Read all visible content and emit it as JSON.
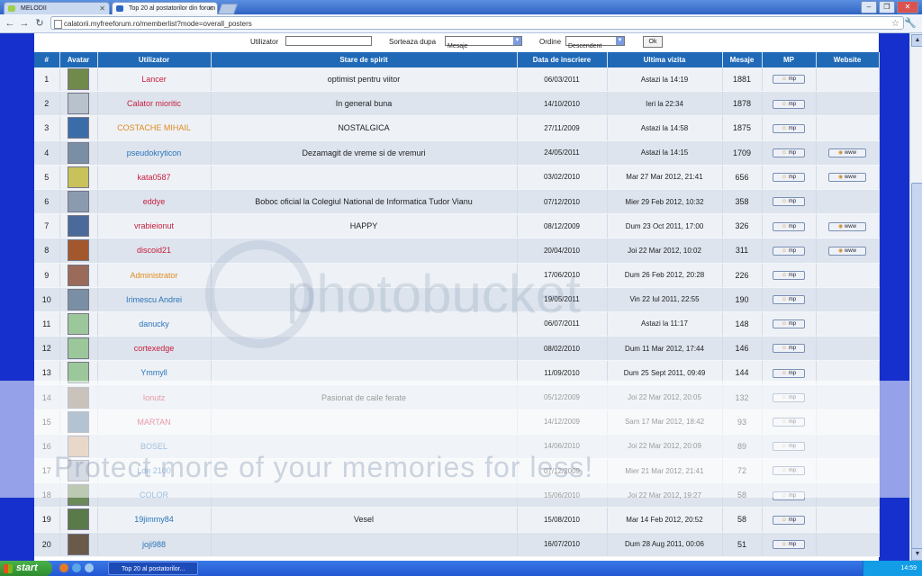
{
  "browser": {
    "tabs": [
      {
        "label": "MELODII",
        "favicon_color": "#9fcf4a"
      },
      {
        "label": "Top 20 al postatorilor din forum",
        "favicon_color": "#2b65c4"
      }
    ],
    "url": "calatorii.myfreeforum.ro/memberlist?mode=overall_posters"
  },
  "filter": {
    "user_label": "Utilizator",
    "user_value": "",
    "sort_label": "Sorteaza dupa",
    "sort_value": "Mesaje",
    "order_label": "Ordine",
    "order_value": "Descendent",
    "ok_label": "Ok"
  },
  "table": {
    "headers": [
      "#",
      "Avatar",
      "Utilizator",
      "Stare de spirit",
      "Data de inscriere",
      "Ultima vizita",
      "Mesaje",
      "MP",
      "Website"
    ],
    "mp_label": "mp",
    "www_label": "www",
    "rows": [
      {
        "rank": "1",
        "user": "Lancer",
        "user_color": "#c81e3c",
        "mood": "optimist pentru viitor",
        "joined": "06/03/2011",
        "last": "Astazi la 14:19",
        "posts": "1881",
        "www": false,
        "avatar_color": "#6f8a4a"
      },
      {
        "rank": "2",
        "user": "Calator mioritic",
        "user_color": "#c81e3c",
        "mood": "In general buna",
        "joined": "14/10/2010",
        "last": "Ieri la 22:34",
        "posts": "1878",
        "www": false,
        "avatar_color": "#b8c2cc"
      },
      {
        "rank": "3",
        "user": "COSTACHE MIHAIL",
        "user_color": "#e08a1e",
        "mood": "NOSTALGICA",
        "joined": "27/11/2009",
        "last": "Astazi la 14:58",
        "posts": "1875",
        "www": false,
        "avatar_color": "#3a6da8"
      },
      {
        "rank": "4",
        "user": "pseudokryticon",
        "user_color": "#2a74b8",
        "mood": "Dezamagit de vreme si de vremuri",
        "joined": "24/05/2011",
        "last": "Astazi la 14:15",
        "posts": "1709",
        "www": true,
        "avatar_color": "#7a8fa3"
      },
      {
        "rank": "5",
        "user": "kata0587",
        "user_color": "#c81e3c",
        "mood": "",
        "joined": "03/02/2010",
        "last": "Mar 27 Mar 2012, 21:41",
        "posts": "656",
        "www": true,
        "avatar_color": "#c9c25a"
      },
      {
        "rank": "6",
        "user": "eddye",
        "user_color": "#c81e3c",
        "mood": "Boboc oficial la Colegiul National de Informatica Tudor Vianu",
        "joined": "07/12/2010",
        "last": "Mier 29 Feb 2012, 10:32",
        "posts": "358",
        "www": false,
        "avatar_color": "#8a9bb0"
      },
      {
        "rank": "7",
        "user": "vrabieionut",
        "user_color": "#c81e3c",
        "mood": "HAPPY",
        "joined": "08/12/2009",
        "last": "Dum 23 Oct 2011, 17:00",
        "posts": "326",
        "www": true,
        "avatar_color": "#4a6a9a"
      },
      {
        "rank": "8",
        "user": "discoid21",
        "user_color": "#c81e3c",
        "mood": "",
        "joined": "20/04/2010",
        "last": "Joi 22 Mar 2012, 10:02",
        "posts": "311",
        "www": true,
        "avatar_color": "#a3572c"
      },
      {
        "rank": "9",
        "user": "Administrator",
        "user_color": "#e08a1e",
        "mood": "",
        "joined": "17/06/2010",
        "last": "Dum 26 Feb 2012, 20:28",
        "posts": "226",
        "www": false,
        "avatar_color": "#9a6a5a"
      },
      {
        "rank": "10",
        "user": "Irimescu Andrei",
        "user_color": "#2a74b8",
        "mood": "",
        "joined": "19/05/2011",
        "last": "Vin 22 Iul 2011, 22:55",
        "posts": "190",
        "www": false,
        "avatar_color": "#7a8fa3"
      },
      {
        "rank": "11",
        "user": "danucky",
        "user_color": "#2a74b8",
        "mood": "",
        "joined": "06/07/2011",
        "last": "Astazi la 11:17",
        "posts": "148",
        "www": false,
        "avatar_color": "#9cc79a"
      },
      {
        "rank": "12",
        "user": "cortexedge",
        "user_color": "#c81e3c",
        "mood": "",
        "joined": "08/02/2010",
        "last": "Dum 11 Mar 2012, 17:44",
        "posts": "146",
        "www": false,
        "avatar_color": "#9cc79a"
      },
      {
        "rank": "13",
        "user": "Ymmyll",
        "user_color": "#2a74b8",
        "mood": "",
        "joined": "11/09/2010",
        "last": "Dum 25 Sept 2011, 09:49",
        "posts": "144",
        "www": false,
        "avatar_color": "#9cc79a"
      },
      {
        "rank": "14",
        "user": "Ionutz",
        "user_color": "#c81e3c",
        "mood": "Pasionat de caile ferate",
        "joined": "05/12/2009",
        "last": "Joi 22 Mar 2012, 20:05",
        "posts": "132",
        "www": false,
        "avatar_color": "#8a7a6a"
      },
      {
        "rank": "15",
        "user": "MARTAN",
        "user_color": "#c81e3c",
        "mood": "",
        "joined": "14/12/2009",
        "last": "Sam 17 Mar 2012, 18:42",
        "posts": "93",
        "www": false,
        "avatar_color": "#5a7a9a"
      },
      {
        "rank": "16",
        "user": "BOSEL",
        "user_color": "#2a74b8",
        "mood": "",
        "joined": "14/06/2010",
        "last": "Joi 22 Mar 2012, 20:09",
        "posts": "89",
        "www": false,
        "avatar_color": "#c9a98a"
      },
      {
        "rank": "17",
        "user": "Lde 2100",
        "user_color": "#2a74b8",
        "mood": "",
        "joined": "07/12/2009",
        "last": "Mier 21 Mar 2012, 21:41",
        "posts": "72",
        "www": false,
        "avatar_color": "#a3b0c0"
      },
      {
        "rank": "18",
        "user": "COLOR",
        "user_color": "#2a74b8",
        "mood": "",
        "joined": "15/06/2010",
        "last": "Joi 22 Mar 2012, 19:27",
        "posts": "58",
        "www": false,
        "avatar_color": "#6a8a5a"
      },
      {
        "rank": "19",
        "user": "19jimmy84",
        "user_color": "#2a74b8",
        "mood": "Vesel",
        "joined": "15/08/2010",
        "last": "Mar 14 Feb 2012, 20:52",
        "posts": "58",
        "www": false,
        "avatar_color": "#5a7a4a"
      },
      {
        "rank": "20",
        "user": "joji988",
        "user_color": "#2a74b8",
        "mood": "",
        "joined": "16/07/2010",
        "last": "Dum 28 Aug 2011, 00:06",
        "posts": "51",
        "www": false,
        "avatar_color": "#6a5a4a"
      }
    ]
  },
  "watermark": {
    "logo": "photobucket",
    "text": "Protect more of your memories for less!"
  },
  "taskbar": {
    "start_label": "start",
    "task_item": "Top 20 al postatorilor...",
    "clock": "14:59"
  }
}
